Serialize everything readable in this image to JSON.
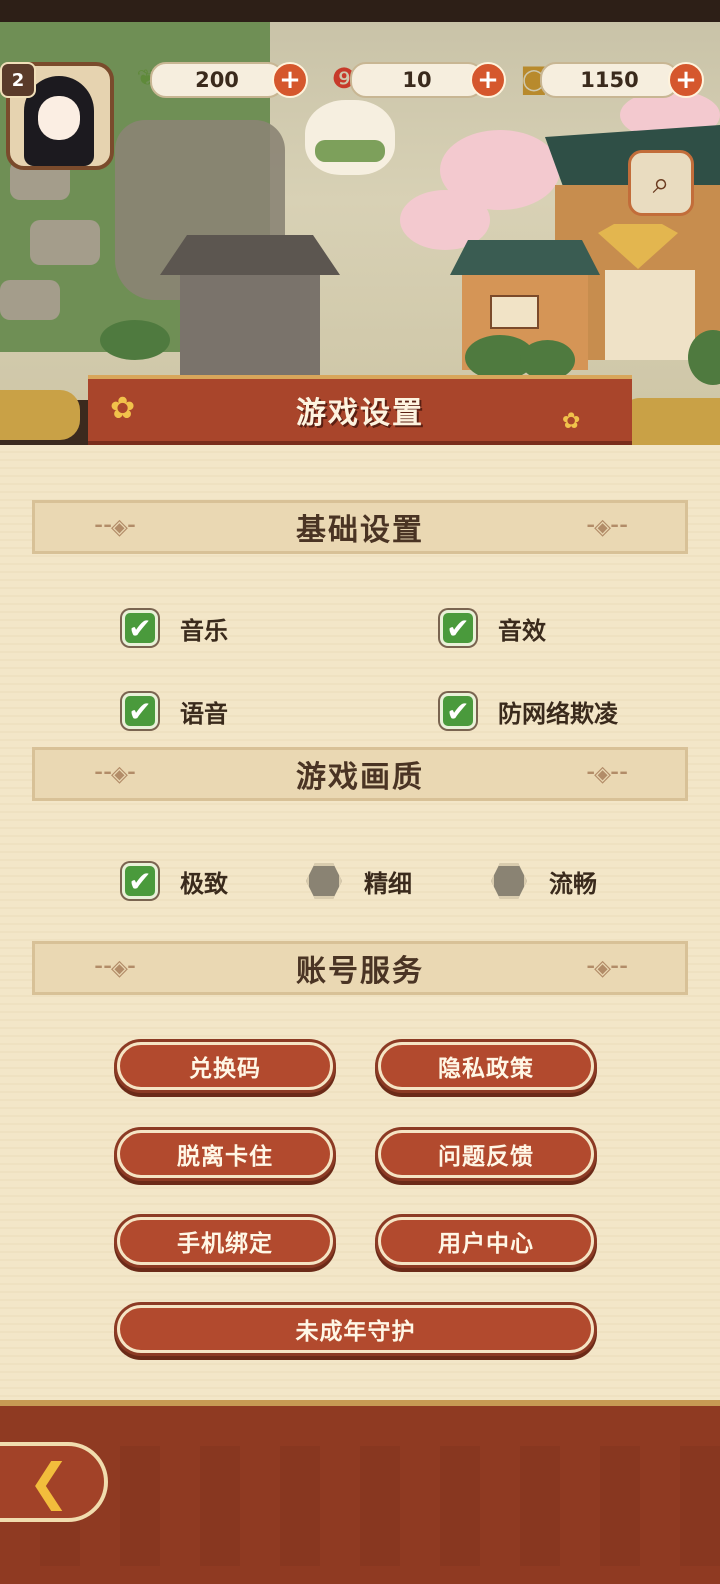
{
  "hud": {
    "level": "2",
    "resources": [
      {
        "icon": "leaf-icon",
        "value": "200"
      },
      {
        "icon": "red-magatama-icon",
        "value": "10"
      },
      {
        "icon": "coin-icon",
        "value": "1150"
      }
    ],
    "plus_glyph": "+",
    "scene_button_icon": "scroll-search-icon"
  },
  "dialog": {
    "title": "游戏设置"
  },
  "basic_settings": {
    "header": "基础设置",
    "options": [
      {
        "label": "音乐",
        "checked": true
      },
      {
        "label": "音效",
        "checked": true
      },
      {
        "label": "语音",
        "checked": true
      },
      {
        "label": "防网络欺凌",
        "checked": true
      }
    ]
  },
  "quality": {
    "header": "游戏画质",
    "options": [
      {
        "label": "极致",
        "selected": true
      },
      {
        "label": "精细",
        "selected": false
      },
      {
        "label": "流畅",
        "selected": false
      }
    ]
  },
  "account": {
    "header": "账号服务",
    "buttons": [
      "兑换码",
      "隐私政策",
      "脱离卡住",
      "问题反馈",
      "手机绑定",
      "用户中心",
      "未成年守护"
    ]
  },
  "colors": {
    "accent_red": "#b24a2e",
    "check_green": "#4a9a3c",
    "panel_bg": "#f3e6c8",
    "gold": "#c9a146"
  },
  "glyphs": {
    "check": "✔",
    "back": "❮"
  }
}
